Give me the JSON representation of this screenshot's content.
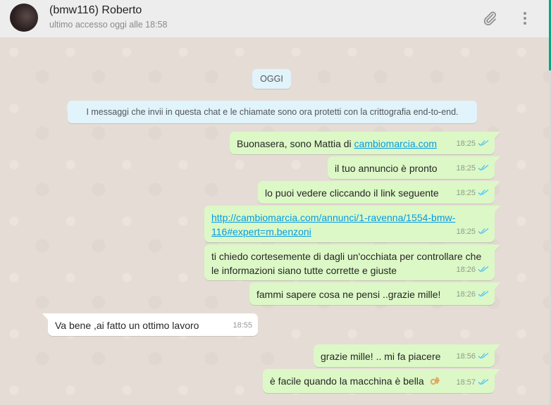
{
  "header": {
    "contact_name": "(bmw116) Roberto",
    "last_seen": "ultimo accesso oggi alle 18:58",
    "icons": [
      "paperclip-icon",
      "menu-dots-icon"
    ]
  },
  "chat": {
    "day_label": "OGGI",
    "system_message": "I messaggi che invii in questa chat e le chiamate sono ora protetti con la crittografia end-to-end.",
    "messages": [
      {
        "dir": "out",
        "text_before": "Buonasera, sono Mattia di ",
        "link": "cambiomarcia.com",
        "time": "18:25"
      },
      {
        "dir": "out",
        "text": "il tuo annuncio è pronto",
        "time": "18:25"
      },
      {
        "dir": "out",
        "text": "lo puoi vedere cliccando il link seguente",
        "time": "18:25"
      },
      {
        "dir": "out",
        "link_line1": "http://cambiomarcia.com/annunci/1-ravenna/1554-bmw-",
        "link_line2": "116#expert=m.benzoni",
        "time": "18:25"
      },
      {
        "dir": "out",
        "line1": "ti chiedo cortesemente di dagli un'occhiata per controllare che",
        "line2": "le informazioni siano tutte corrette e giuste",
        "time": "18:26"
      },
      {
        "dir": "out",
        "text": "fammi sapere cosa ne pensi ..grazie mille!",
        "time": "18:26"
      },
      {
        "dir": "in",
        "text": "Va bene ,ai fatto un ottimo lavoro",
        "time": "18:55"
      },
      {
        "dir": "out",
        "text": "grazie mille! .. mi fa piacere",
        "time": "18:56"
      },
      {
        "dir": "out",
        "text": "è facile quando la macchina è bella",
        "emoji": "ok-hand-icon",
        "time": "18:57"
      }
    ]
  },
  "colors": {
    "outgoing_bubble": "#dcf8c6",
    "incoming_bubble": "#ffffff",
    "system_pill": "#e1f3fb",
    "read_ticks": "#4fc3f7",
    "link": "#039be5",
    "chat_background": "#e5ddd5",
    "header_background": "#ededed"
  }
}
